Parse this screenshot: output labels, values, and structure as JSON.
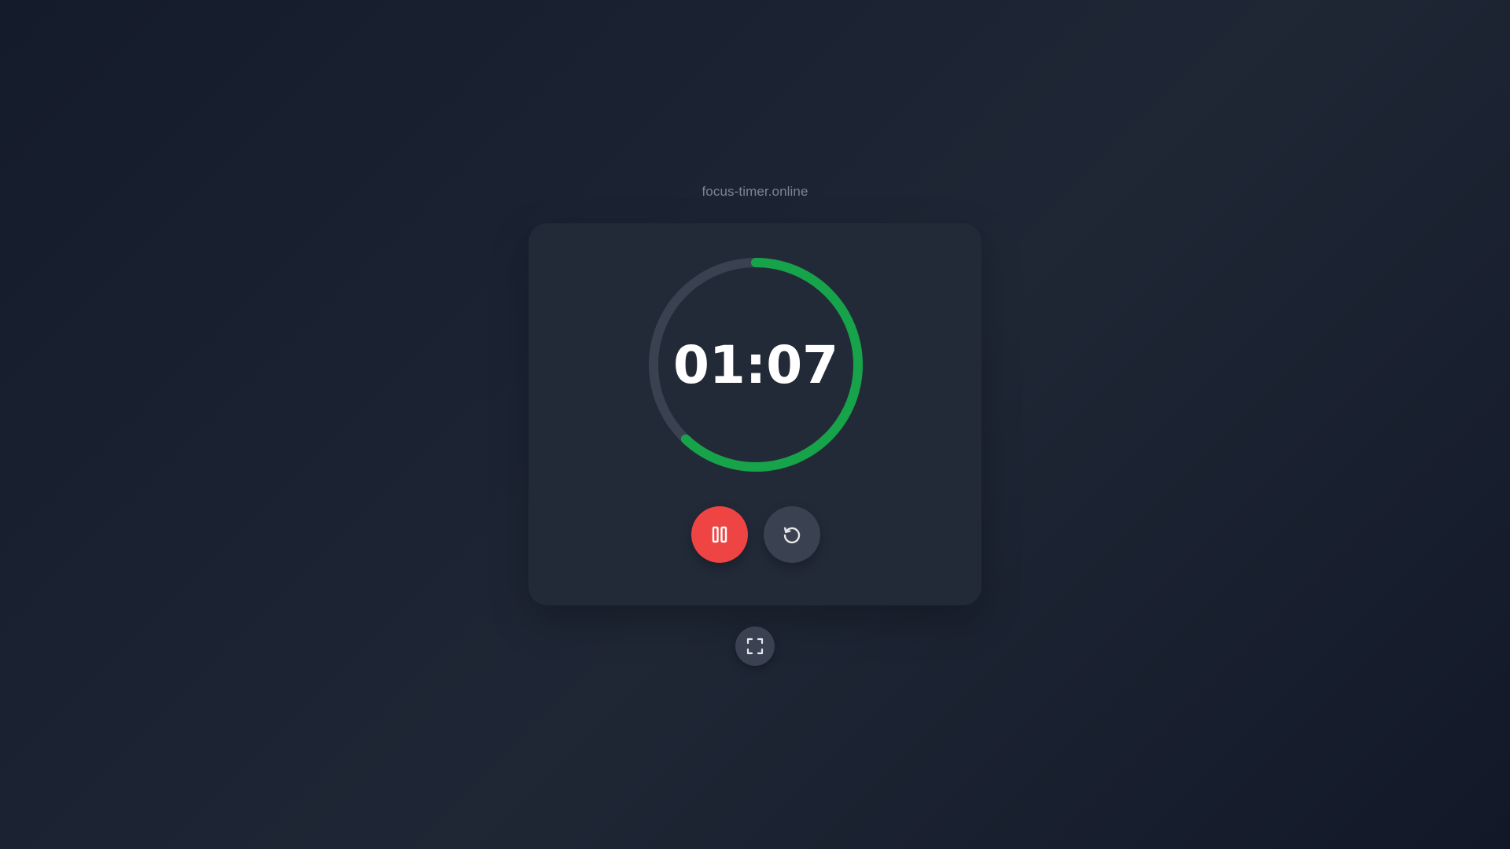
{
  "site": {
    "label": "focus-timer.online"
  },
  "timer": {
    "display": "01:07",
    "progress_fraction": 0.62
  },
  "colors": {
    "progress": "#16a34a",
    "track": "#3a4150",
    "pause_button": "#ef4444",
    "secondary_button": "#3a4150"
  },
  "icons": {
    "pause": "pause-icon",
    "reset": "reset-icon",
    "fullscreen": "fullscreen-icon"
  }
}
